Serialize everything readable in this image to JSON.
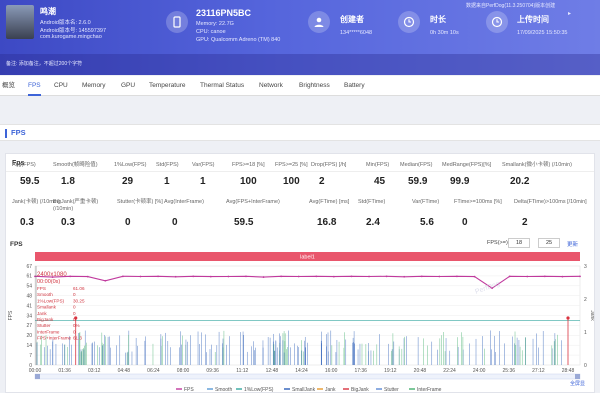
{
  "header": {
    "username": "鸣潮",
    "app_version": "Android版本名: 2.6.0",
    "app_code": "Android版本号: 145597397",
    "package": "com.kurogame.mingchao",
    "device_model": "23116PN5BC",
    "memory": "Memory: 22.7G",
    "cpu": "CPU: canoe",
    "gpu": "GPU: Qualcomm Adreno (TM) 840",
    "creator_label": "创建者",
    "creator_value": "134*****6048",
    "duration_label": "时长",
    "duration_value": "0h 30m 10s",
    "upload_label": "上传时间",
    "upload_value": "17/09/2025 15:50:35",
    "source": "数据来自PerfDog(11.3.250704)版本创建",
    "note": "备注: 添加备注，不超过200个字符"
  },
  "tabs": [
    "概览",
    "FPS",
    "CPU",
    "Memory",
    "GPU",
    "Temperature",
    "Thermal Status",
    "Network",
    "Brightness",
    "Battery"
  ],
  "section_title": "FPS",
  "panel_title": "Fps",
  "stats_row1": [
    {
      "label": "Avg(FPS)",
      "value": "59.5"
    },
    {
      "label": "Smooth(帧畸险值)",
      "value": "1.8"
    },
    {
      "label": "1%Low(FPS)",
      "value": "29"
    },
    {
      "label": "Std(FPS)",
      "value": "1"
    },
    {
      "label": "Var(FPS)",
      "value": "1"
    },
    {
      "label": "FPS>=18 [%]",
      "value": "100"
    },
    {
      "label": "FPS>=25 [%]",
      "value": "100"
    },
    {
      "label": "Drop(FPS) [/h]",
      "value": "2"
    },
    {
      "label": "Min(FPS)",
      "value": "45"
    },
    {
      "label": "Median(FPS)",
      "value": "59.9"
    },
    {
      "label": "MedRange(FPS)[%]",
      "value": "99.9"
    },
    {
      "label": "Smallank(微小卡顿) (/10min)",
      "value": "20.2"
    }
  ],
  "stats_row2": [
    {
      "label": "Jank(卡顿) (/10min)",
      "value": "0.3"
    },
    {
      "label": "BigJank(严重卡顿) (/10min)",
      "value": "0.3"
    },
    {
      "label": "Stutter(卡顿率) [%]",
      "value": "0"
    },
    {
      "label": "Avg(InterFrame)",
      "value": "0"
    },
    {
      "label": "Avg(FPS+InterFrame)",
      "value": "59.5"
    },
    {
      "label": "Avg(FTime) [ms]",
      "value": "16.8"
    },
    {
      "label": "Std(FTime)",
      "value": "2.4"
    },
    {
      "label": "Var(FTime)",
      "value": "5.6"
    },
    {
      "label": "FTime>=100ms [%]",
      "value": "0"
    },
    {
      "label": "Delta(FTime)>100ms [/10min]",
      "value": "2"
    }
  ],
  "chart_header": {
    "title": "FPS",
    "range_label": "FPS(>=)",
    "range_min": "18",
    "range_max": "25",
    "apply": "更新"
  },
  "chart_label_band": "label1",
  "resolution": "2400x1080",
  "cursor_time": "00:00(0s)",
  "tooltip": [
    {
      "name": "FPS",
      "value": "61.06"
    },
    {
      "name": "Smooth",
      "value": "0"
    },
    {
      "name": "1%Low(FPS)",
      "value": "30.25"
    },
    {
      "name": "Smallank",
      "value": "0"
    },
    {
      "name": "Jank",
      "value": "0"
    },
    {
      "name": "BigJank",
      "value": "0"
    },
    {
      "name": "Stutter",
      "value": "0%"
    },
    {
      "name": "InterFrame",
      "value": "0"
    },
    {
      "name": "FPS+InterFrame",
      "value": "61.3"
    }
  ],
  "legend": [
    {
      "name": "FPS",
      "color": "#c0399d"
    },
    {
      "name": "Smooth",
      "color": "#5b9bd5"
    },
    {
      "name": "1%Low(FPS)",
      "color": "#36a8a0"
    },
    {
      "name": "SmallJank",
      "color": "#2d5fb8"
    },
    {
      "name": "Jank",
      "color": "#e69a2e"
    },
    {
      "name": "BigJank",
      "color": "#d9333f"
    },
    {
      "name": "Stutter",
      "color": "#5e8ad4"
    },
    {
      "name": "InterFrame",
      "color": "#45b06e"
    }
  ],
  "full_screen": "全屏显",
  "watermark": "PerfDog",
  "chart_data": {
    "type": "line",
    "ylabel": "FPS",
    "y2label": "Jank",
    "ylim": [
      0,
      67
    ],
    "y_ticks": [
      "67",
      "61",
      "54",
      "48",
      "41",
      "34",
      "27",
      "20",
      "14",
      "7",
      "0"
    ],
    "y2_ticks": [
      "3",
      "2",
      "1",
      "0"
    ],
    "x_ticks": [
      "00:00",
      "01:36",
      "03:12",
      "04:48",
      "06:24",
      "08:00",
      "09:36",
      "11:12",
      "12:48",
      "14:24",
      "16:00",
      "17:36",
      "19:12",
      "20:48",
      "22:24",
      "24:00",
      "25:36",
      "27:12",
      "28:48"
    ],
    "series": [
      {
        "name": "FPS",
        "values": [
          60,
          59.5,
          60,
          59.8,
          57,
          60,
          59.9,
          60,
          59.7,
          60,
          59.8,
          59.9,
          60,
          59.5,
          60,
          59.9,
          60,
          59.8,
          60,
          59.9,
          60,
          59.7,
          60,
          59.9,
          60,
          59.8,
          52,
          60,
          59.9,
          60,
          59.8,
          60
        ]
      },
      {
        "name": "1%Low(FPS)",
        "values": [
          30,
          30,
          30,
          30,
          30,
          30,
          30,
          30,
          30,
          30,
          30,
          30,
          30,
          30,
          30,
          30,
          30,
          30,
          30,
          30,
          30,
          30,
          30,
          30,
          30,
          30,
          30,
          30,
          30,
          30,
          30,
          30
        ]
      }
    ],
    "bigjank_times": [
      "02:12",
      "28:48"
    ]
  }
}
